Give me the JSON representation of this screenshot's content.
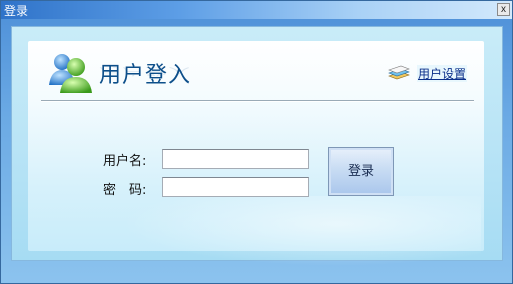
{
  "window": {
    "title": "登录",
    "close_label": "x"
  },
  "header": {
    "title": "用户登入",
    "settings_link": "用户设置"
  },
  "form": {
    "username_label": "用户名:",
    "password_label": "密　码:",
    "username_value": "",
    "password_value": "",
    "login_button": "登录"
  },
  "icons": {
    "logo": "users-icon",
    "settings": "books-icon"
  },
  "colors": {
    "title_blue": "#0d4f8a",
    "link_blue": "#0b2f8a",
    "frame_blue": "#4d8fd8"
  }
}
